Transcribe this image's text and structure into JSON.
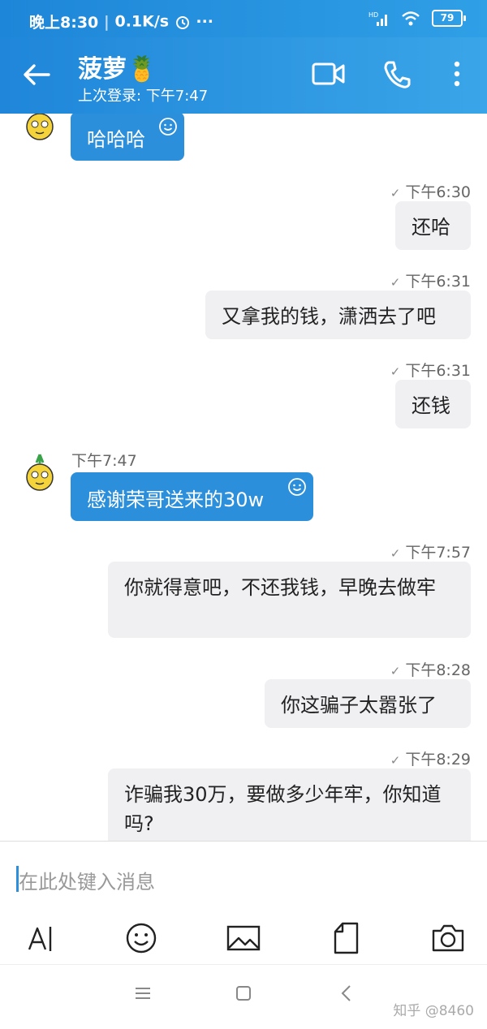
{
  "status_bar": {
    "time": "晚上8:30",
    "network_speed": "0.1K/s",
    "more": "···",
    "signal": "HD",
    "battery": "79"
  },
  "header": {
    "title": "菠萝🍍",
    "subtitle": "上次登录: 下午7:47"
  },
  "messages": [
    {
      "dir": "in",
      "text": "哈哈哈"
    },
    {
      "dir": "out",
      "time": "下午6:30",
      "text": "还哈"
    },
    {
      "dir": "out",
      "time": "下午6:31",
      "text": "又拿我的钱，潇洒去了吧"
    },
    {
      "dir": "out",
      "time": "下午6:31",
      "text": "还钱"
    },
    {
      "dir": "in",
      "time": "下午7:47",
      "text": "感谢荣哥送来的30w"
    },
    {
      "dir": "out",
      "time": "下午7:57",
      "text": "你就得意吧，不还我钱，早晚去做牢"
    },
    {
      "dir": "out",
      "time": "下午8:28",
      "text": "你这骗子太嚣张了"
    },
    {
      "dir": "out",
      "time": "下午8:29",
      "text": "诈骗我30万，要做多少年牢，你知道吗?"
    }
  ],
  "input": {
    "placeholder": "在此处键入消息"
  },
  "watermark": "知乎 @8460",
  "colors": {
    "accent": "#2b8fdc",
    "outgoing_bubble": "#f0f0f3"
  }
}
